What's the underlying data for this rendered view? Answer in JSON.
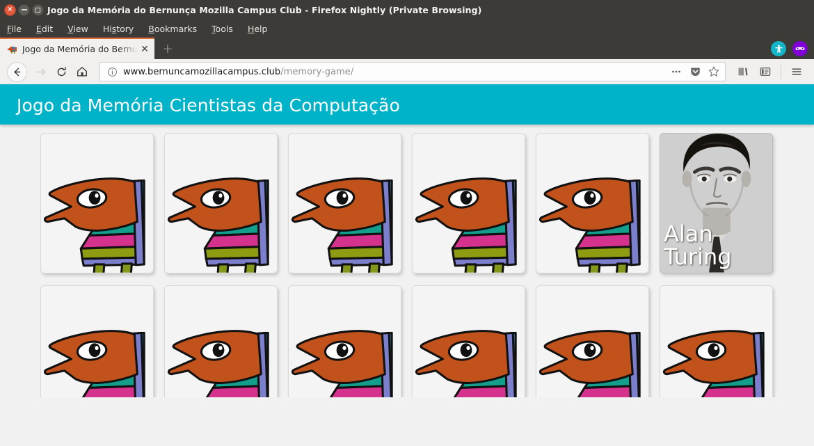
{
  "window": {
    "title": "Jogo da Memória do Bernunça Mozilla Campus Club - Firefox Nightly (Private Browsing)",
    "close_label": "×"
  },
  "menubar": {
    "items": [
      {
        "pre": "",
        "accel": "F",
        "post": "ile"
      },
      {
        "pre": "",
        "accel": "E",
        "post": "dit"
      },
      {
        "pre": "",
        "accel": "V",
        "post": "iew"
      },
      {
        "pre": "Hi",
        "accel": "s",
        "post": "tory"
      },
      {
        "pre": "",
        "accel": "B",
        "post": "ookmarks"
      },
      {
        "pre": "",
        "accel": "T",
        "post": "ools"
      },
      {
        "pre": "",
        "accel": "H",
        "post": "elp"
      }
    ]
  },
  "tabstrip": {
    "tab_label": "Jogo da Memória do Bernunça Mozilla Campus Club",
    "tab_close_label": "✕",
    "newtab_label": "+",
    "a11y_icon": "accessibility-icon",
    "private_icon": "private-browsing-mask-icon"
  },
  "navbar": {
    "back_icon": "back-arrow-icon",
    "forward_icon": "forward-arrow-icon",
    "reload_icon": "reload-icon",
    "home_icon": "home-icon",
    "info_icon": "page-info-icon",
    "url_domain": "www.bernuncamozillacampus.club",
    "url_path": "/memory-game/",
    "page_actions_icon": "ellipsis-icon",
    "pocket_icon": "pocket-icon",
    "bookmark_icon": "star-icon",
    "library_icon": "library-icon",
    "sidebar_icon": "sidebar-icon",
    "menu_icon": "hamburger-menu-icon"
  },
  "page": {
    "header_title": "Jogo da Memória Cientistas da Computação",
    "header_color": "#00b3c8",
    "background_color": "#f1f1f1"
  },
  "game": {
    "card_back_icon": "bernunca-mascot-icon",
    "cards": [
      {
        "state": "face-down",
        "name": ""
      },
      {
        "state": "face-down",
        "name": ""
      },
      {
        "state": "face-down",
        "name": ""
      },
      {
        "state": "face-down",
        "name": ""
      },
      {
        "state": "face-down",
        "name": ""
      },
      {
        "state": "face-up",
        "name": "Alan Turing"
      },
      {
        "state": "face-down",
        "name": ""
      },
      {
        "state": "face-down",
        "name": ""
      },
      {
        "state": "face-down",
        "name": ""
      },
      {
        "state": "face-down",
        "name": ""
      },
      {
        "state": "face-down",
        "name": ""
      },
      {
        "state": "face-down",
        "name": ""
      }
    ],
    "mascot_colors": {
      "head": "#c1521b",
      "stripe_blue": "#2f86c5",
      "stripe_red": "#d6373f",
      "stripe_teal": "#149e8c",
      "stripe_pink": "#d4328d",
      "stripe_olive": "#8e9c12",
      "band_purple": "#7b7fcc",
      "legs": "#86981a"
    }
  }
}
